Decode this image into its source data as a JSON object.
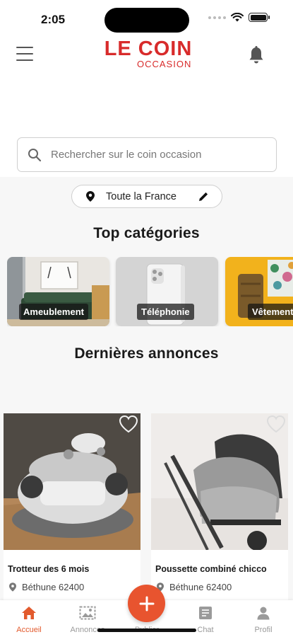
{
  "status_bar": {
    "time": "2:05"
  },
  "header": {
    "logo_main": "LE COIN",
    "logo_sub": "OCCASION"
  },
  "search": {
    "placeholder": "Rechercher sur le coin occasion"
  },
  "location": {
    "label": "Toute la France"
  },
  "top_categories": {
    "title": "Top catégories",
    "items": [
      {
        "label": "Ameublement",
        "icon": "sofa-photo"
      },
      {
        "label": "Téléphonie",
        "icon": "phone-photo"
      },
      {
        "label": "Vêtements",
        "icon": "clothes-photo"
      }
    ]
  },
  "latest_listings": {
    "title": "Dernières annonces",
    "items": [
      {
        "title": "Trotteur des 6 mois",
        "location": "Béthune 62400",
        "favorite": false
      },
      {
        "title": "Poussette combiné chicco",
        "location": "Béthune 62400",
        "favorite": false
      }
    ]
  },
  "bottom_nav": {
    "items": [
      {
        "label": "Accueil",
        "icon": "home-icon",
        "active": true
      },
      {
        "label": "Annonces",
        "icon": "image-icon",
        "active": false
      },
      {
        "label": "Publier",
        "icon": "plus-icon",
        "active": false
      },
      {
        "label": "Chat",
        "icon": "chat-icon",
        "active": false
      },
      {
        "label": "Profil",
        "icon": "person-icon",
        "active": false
      }
    ]
  },
  "colors": {
    "brand": "#d82b2b",
    "accent": "#e8542f",
    "inactive_nav": "#9a9a9a"
  }
}
